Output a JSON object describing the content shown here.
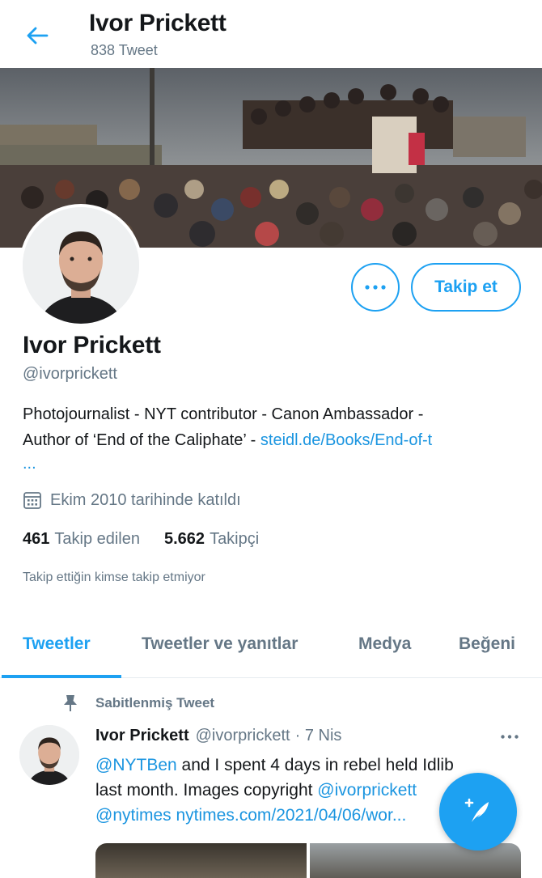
{
  "header": {
    "title": "Ivor Prickett",
    "tweet_count": "838 Tweet"
  },
  "profile": {
    "name": "Ivor Prickett",
    "handle": "@ivorprickett",
    "bio_line1": "Photojournalist - NYT contributor - Canon Ambassador -",
    "bio_line2_text": "Author of ‘End of the Caliphate’ - ",
    "bio_line2_link": "steidl.de/Books/End-of-t",
    "bio_more": "...",
    "joined": "Ekim 2010 tarihinde katıldı",
    "following_count": "461",
    "following_label": "Takip edilen",
    "followers_count": "5.662",
    "followers_label": "Takipçi",
    "mutual_note": "Takip ettiğin kimse takip etmiyor",
    "follow_label": "Takip et"
  },
  "tabs": [
    {
      "label": "Tweetler",
      "active": true
    },
    {
      "label": "Tweetler ve yanıtlar",
      "active": false
    },
    {
      "label": "Medya",
      "active": false
    },
    {
      "label": "Beğeni",
      "active": false
    }
  ],
  "tweet": {
    "pinned_label": "Sabitlenmiş Tweet",
    "author": "Ivor Prickett",
    "handle": "@ivorprickett",
    "time": "· 7 Nis",
    "mention1": "@NYTBen",
    "line1_text": " and I spent 4 days in rebel held Idlib",
    "line2_text": "last month. Images copyright ",
    "line2_link": "@ivorprickett",
    "line3_mention": "@nytimes",
    "line3_link": " nytimes.com/2021/04/06/wor..."
  },
  "colors": {
    "accent": "#1da1f2",
    "link": "#1b95e0",
    "muted": "#657786"
  },
  "icons": [
    "back-arrow-icon",
    "more-icon",
    "calendar-icon",
    "pin-icon",
    "compose-tweet-icon"
  ]
}
